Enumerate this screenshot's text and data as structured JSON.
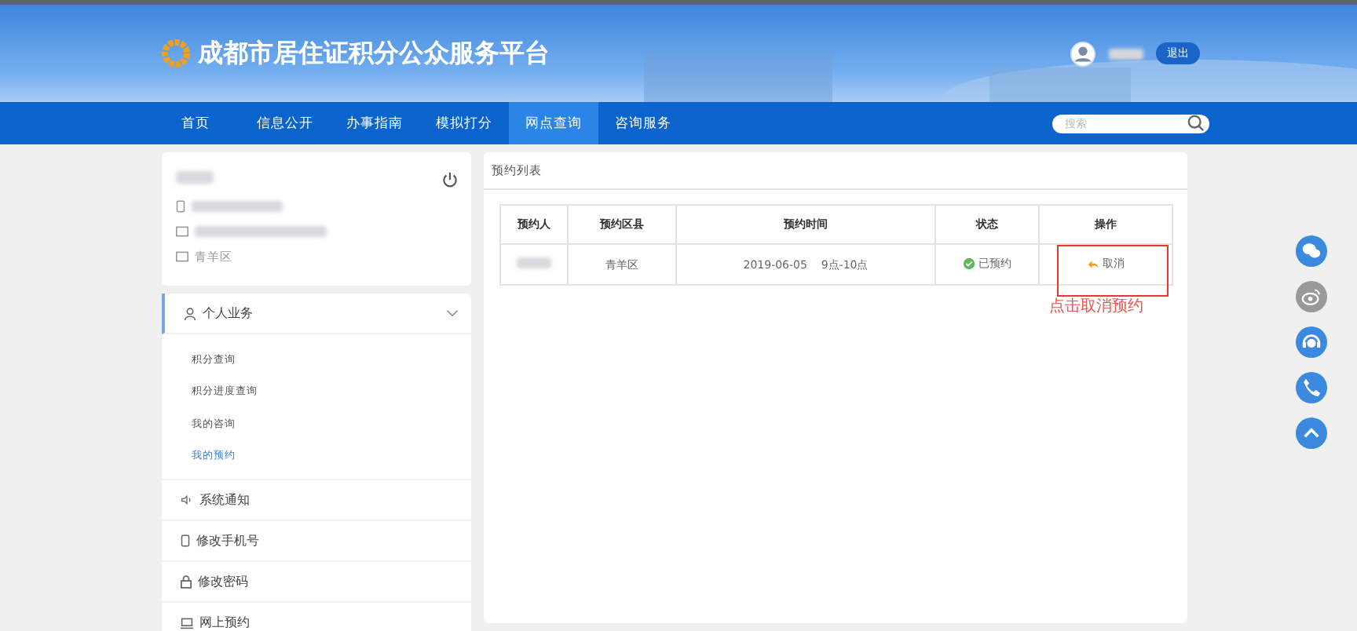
{
  "header": {
    "title": "成都市居住证积分公众服务平台",
    "logout_button": "退出"
  },
  "nav": [
    {
      "label": "首页",
      "selected": false
    },
    {
      "label": "信息公开",
      "selected": false
    },
    {
      "label": "办事指南",
      "selected": false
    },
    {
      "label": "模拟打分",
      "selected": false
    },
    {
      "label": "网点查询",
      "selected": true
    },
    {
      "label": "咨询服务",
      "selected": false
    }
  ],
  "search": {
    "placeholder": "搜索"
  },
  "profile": {
    "district": "青羊区"
  },
  "sidebar": [
    {
      "kind": "group",
      "label": "个人业务",
      "expanded": true,
      "children": [
        {
          "label": "积分查询",
          "selected": false
        },
        {
          "label": "积分进度查询",
          "selected": false
        },
        {
          "label": "我的咨询",
          "selected": false
        },
        {
          "label": "我的预约",
          "selected": true
        }
      ]
    },
    {
      "kind": "speaker",
      "label": "系统通知"
    },
    {
      "kind": "phone",
      "label": "修改手机号"
    },
    {
      "kind": "lock",
      "label": "修改密码"
    },
    {
      "kind": "monitor",
      "label": "网上预约"
    }
  ],
  "panel": {
    "title": "预约列表",
    "table": {
      "columns": [
        "预约人",
        "预约区县",
        "预约时间",
        "状态",
        "操作"
      ],
      "rows": [
        {
          "district": "青羊区",
          "time": "2019-06-05    9点-10点",
          "status": "已预约",
          "action": "取消"
        }
      ]
    },
    "annotation": "点击取消预约"
  }
}
